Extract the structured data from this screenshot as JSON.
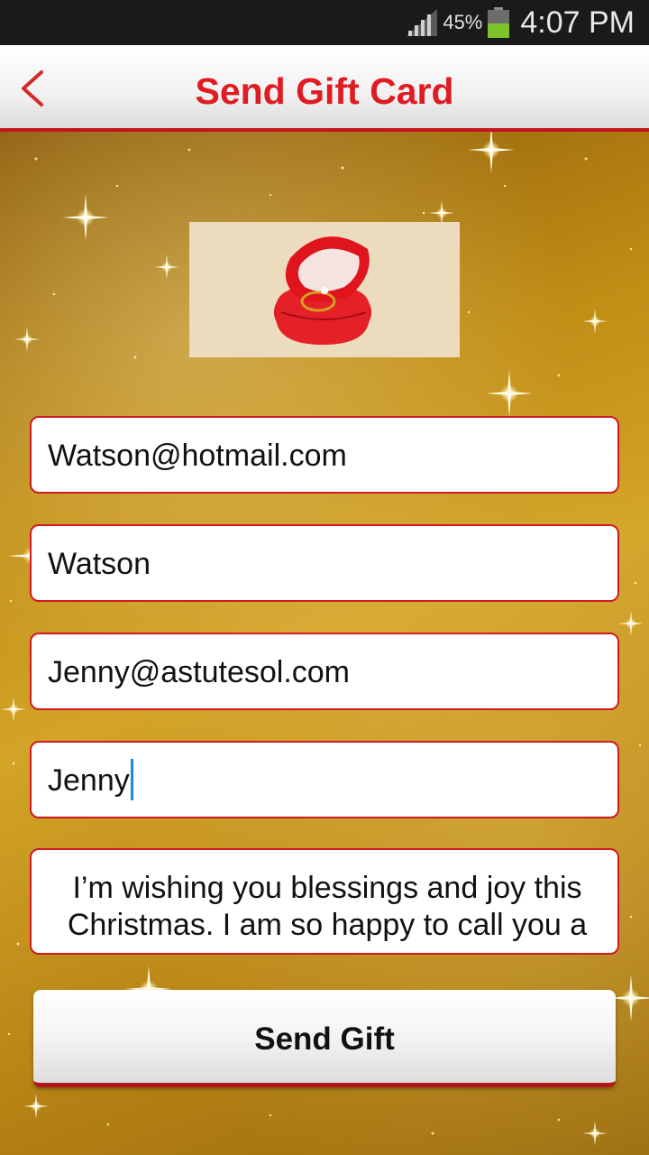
{
  "status_bar": {
    "battery_percent": "45%",
    "battery_level": 0.45,
    "time": "4:07 PM",
    "icons": [
      "signal-icon",
      "battery-icon"
    ]
  },
  "app_bar": {
    "title": "Send Gift Card",
    "back_icon": "back-chevron-icon",
    "accent_color": "#e01b22"
  },
  "gift_image": {
    "subject": "red-ring-box"
  },
  "form": {
    "recipient_email": "Watson@hotmail.com",
    "recipient_name": "Watson",
    "sender_email": "Jenny@astutesol.com",
    "sender_name": "Jenny",
    "message": " I’m wishing you blessings and joy this Christmas. I am so happy to call you a"
  },
  "send_button": {
    "label": "Send Gift"
  }
}
